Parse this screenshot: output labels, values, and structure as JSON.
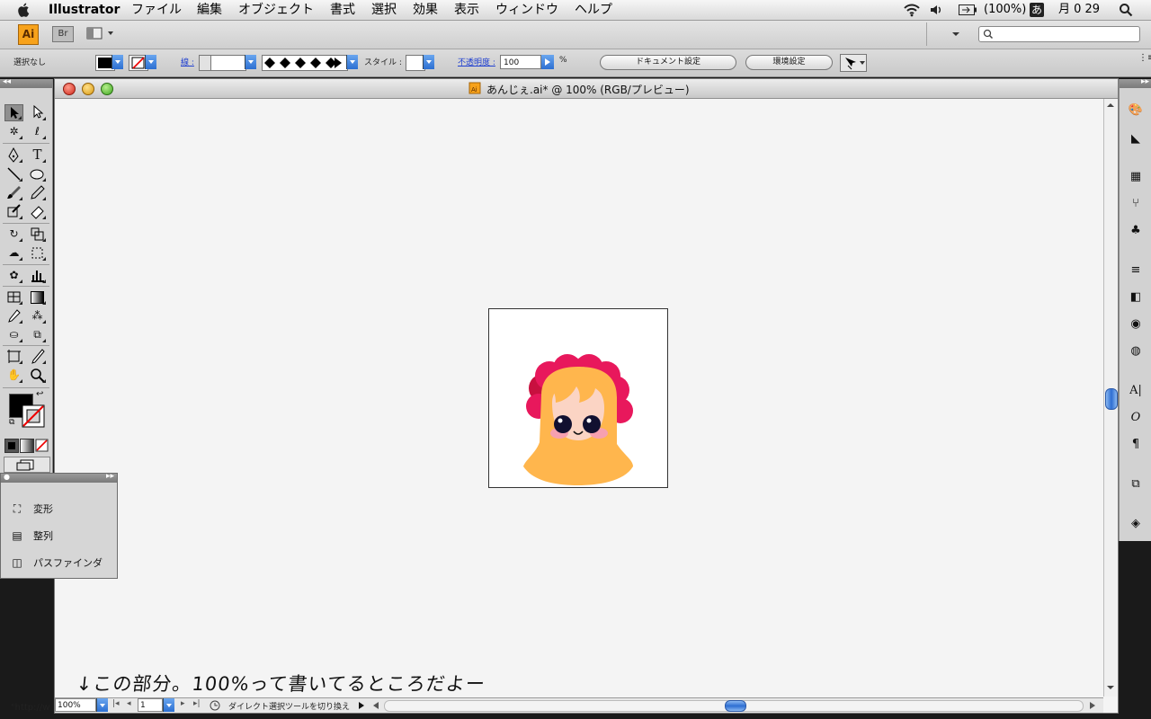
{
  "menubar": {
    "app": "Illustrator",
    "items": [
      "ファイル",
      "編集",
      "オブジェクト",
      "書式",
      "選択",
      "効果",
      "表示",
      "ウィンドウ",
      "ヘルプ"
    ],
    "battery": "(100%)",
    "input_method": "あ",
    "clock": "月 0 29"
  },
  "toolbar": {
    "app_badge": "Ai",
    "bridge_badge": "Br"
  },
  "control": {
    "selection_status": "選択なし",
    "stroke_label": "線 :",
    "style_label": "スタイル :",
    "opacity_label": "不透明度 :",
    "opacity_value": "100",
    "opacity_unit": "%",
    "document_setup": "ドキュメント設定",
    "preferences": "環境設定"
  },
  "document": {
    "title": "あんじぇ.ai* @ 100% (RGB/プレビュー)",
    "zoom": "100%",
    "artboard_number": "1",
    "status_text": "ダイレクト選択ツールを切り換え"
  },
  "mini_panel": {
    "items": [
      {
        "label": "変形",
        "icon": "transform-icon"
      },
      {
        "label": "整列",
        "icon": "align-icon"
      },
      {
        "label": "パスファインダ",
        "icon": "pathfinder-icon"
      }
    ]
  },
  "annotation": "↓この部分。100%って書いてるところだよー",
  "status_url": "\"http://w",
  "colors": {
    "hair": "#FFB64D",
    "flower": "#E8185C",
    "flower_dark": "#C8103F",
    "face": "#FBD4C4",
    "eye": "#111030",
    "cheek": "#F6A0B0"
  }
}
